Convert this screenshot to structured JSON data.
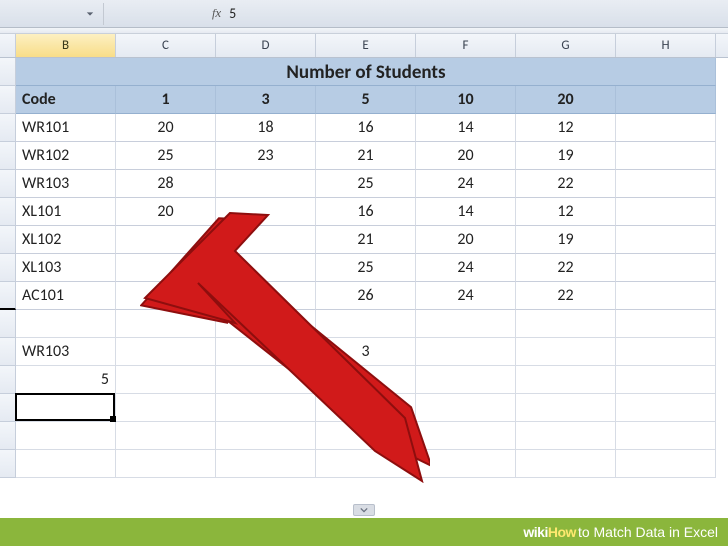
{
  "formula_bar": {
    "value": "5"
  },
  "columns": [
    "B",
    "C",
    "D",
    "E",
    "F",
    "G",
    "H"
  ],
  "selected_column": "B",
  "title_row": {
    "merged_title": "Number of Students"
  },
  "header_row": {
    "code_label": "Code",
    "cols": [
      "1",
      "3",
      "5",
      "10",
      "20"
    ]
  },
  "data_rows": [
    {
      "code": "WR101",
      "v": [
        "20",
        "18",
        "16",
        "14",
        "12"
      ]
    },
    {
      "code": "WR102",
      "v": [
        "25",
        "23",
        "21",
        "20",
        "19"
      ]
    },
    {
      "code": "WR103",
      "v": [
        "28",
        "",
        "25",
        "24",
        "22"
      ]
    },
    {
      "code": "XL101",
      "v": [
        "20",
        "",
        "16",
        "14",
        "12"
      ]
    },
    {
      "code": "XL102",
      "v": [
        "",
        "",
        "21",
        "20",
        "19"
      ]
    },
    {
      "code": "XL103",
      "v": [
        "",
        "",
        "25",
        "24",
        "22"
      ]
    },
    {
      "code": "AC101",
      "v": [
        "",
        "",
        "26",
        "24",
        "22"
      ]
    }
  ],
  "lookup_row": {
    "code": "WR103",
    "e_value": "3"
  },
  "active_cell": {
    "column": "B",
    "value": "5"
  },
  "footer": {
    "brand_a": "wiki",
    "brand_b": "How",
    "article": " to Match Data in Excel"
  },
  "chart_data": {
    "type": "table",
    "title": "Number of Students",
    "columns": [
      "Code",
      "1",
      "3",
      "5",
      "10",
      "20"
    ],
    "rows": [
      [
        "WR101",
        20,
        18,
        16,
        14,
        12
      ],
      [
        "WR102",
        25,
        23,
        21,
        20,
        19
      ],
      [
        "WR103",
        28,
        null,
        25,
        24,
        22
      ],
      [
        "XL101",
        20,
        null,
        16,
        14,
        12
      ],
      [
        "XL102",
        null,
        null,
        21,
        20,
        19
      ],
      [
        "XL103",
        null,
        null,
        25,
        24,
        22
      ],
      [
        "AC101",
        null,
        null,
        26,
        24,
        22
      ]
    ],
    "lookup": {
      "code": "WR103",
      "col_value": 3,
      "result": 5
    }
  }
}
